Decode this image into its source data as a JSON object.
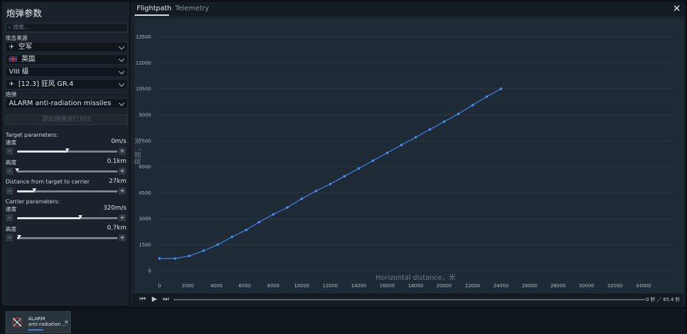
{
  "sidebar": {
    "title": "炮弹参数",
    "search_placeholder": "搜索...",
    "attack_source_label": "攻击来源",
    "selects": [
      {
        "label": "空军"
      },
      {
        "label": "英国"
      },
      {
        "label": "VIII 级"
      },
      {
        "label": "[12.3] 狂风 GR.4"
      }
    ],
    "shell_label": "炮弹",
    "shell_select": "ALARM anti-radiation missiles",
    "add_compare": "添加炮弹进行对比",
    "target_params": "Target parameters:",
    "target_speed_label": "速度",
    "target_speed_value": "0m/s",
    "target_speed_level": 0.5,
    "target_alt_label": "高度",
    "target_alt_value": "0.1km",
    "target_alt_level": 0.0,
    "distance_label": "Distance from target to carrier",
    "distance_value": "27km",
    "distance_level": 0.17,
    "carrier_params": "Carrier parameters:",
    "carrier_speed_label": "速度",
    "carrier_speed_value": "320m/s",
    "carrier_speed_level": 0.63,
    "carrier_alt_label": "高度",
    "carrier_alt_value": "0.7km",
    "carrier_alt_level": 0.02
  },
  "tabs": [
    {
      "label": "Flightpath"
    },
    {
      "label": "Telemetry"
    }
  ],
  "timeline": {
    "time": "0 秒 ／ 65.4 秒"
  },
  "tray": {
    "card_line1": "ALARM",
    "card_line2": "anti-radiation ...",
    "close": "×"
  },
  "colors": {
    "line": "#3b7ee0",
    "panel": "#1a232c",
    "plot": "#1e2a36"
  },
  "chart_data": {
    "type": "line",
    "xlabel": "Horizontal distance，米",
    "ylabel": "高度，米",
    "xlim": [
      0,
      36000
    ],
    "ylim": [
      -1000,
      14000
    ],
    "xticks": [
      0,
      2000,
      4000,
      6000,
      8000,
      10000,
      12000,
      14000,
      16000,
      18000,
      20000,
      22000,
      24000,
      26000,
      28000,
      30000,
      32000,
      34000
    ],
    "yticks": [
      0,
      1500,
      3000,
      4500,
      6000,
      7500,
      9000,
      10500,
      12000,
      13500
    ],
    "grid": true,
    "series": [
      {
        "x": [
          0,
          1100,
          2100,
          3100,
          4100,
          5100,
          6100,
          7000,
          8000,
          9000,
          10000,
          11000,
          12000,
          13000,
          14000,
          15000,
          16000,
          17000,
          18000,
          19000,
          20000,
          21000,
          22000,
          23000,
          24000
        ],
        "y": [
          700,
          700,
          850,
          1150,
          1500,
          1950,
          2350,
          2800,
          3250,
          3650,
          4150,
          4600,
          5000,
          5450,
          5900,
          6350,
          6800,
          7250,
          7700,
          8150,
          8600,
          9050,
          9550,
          10050,
          10500
        ]
      }
    ]
  }
}
